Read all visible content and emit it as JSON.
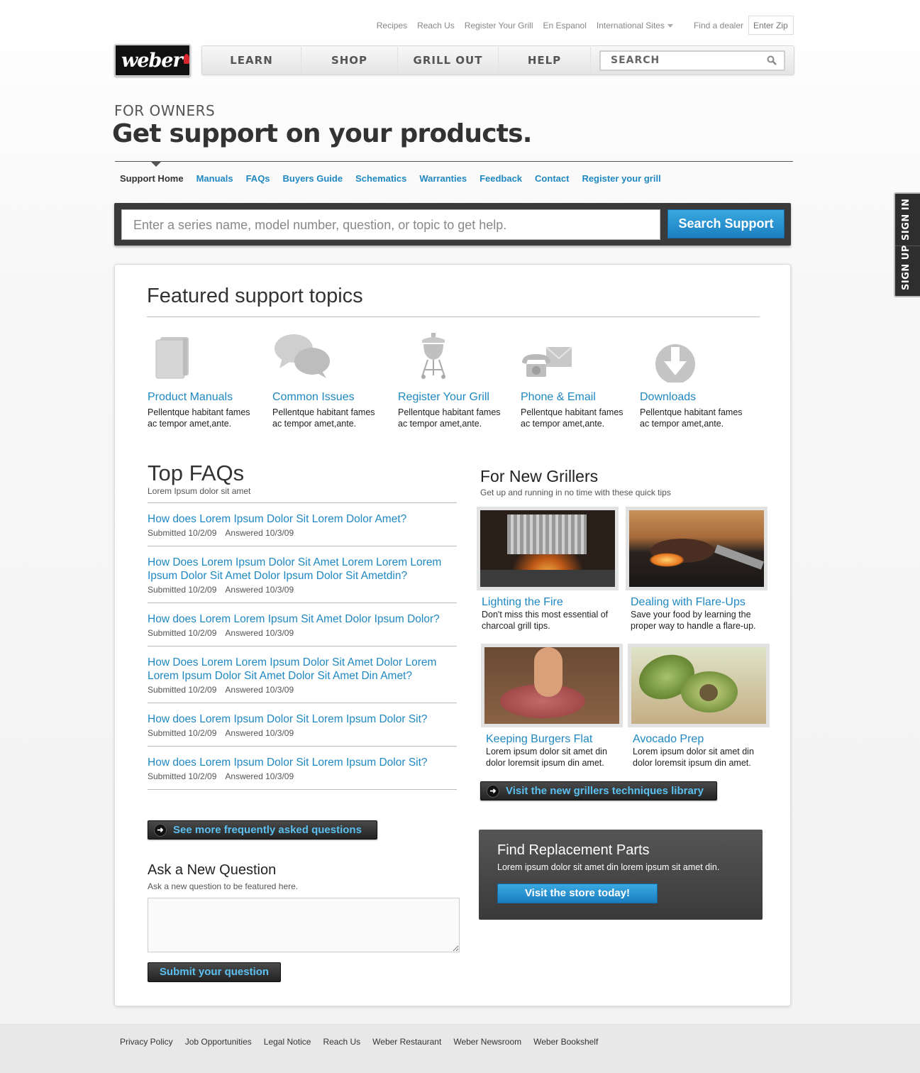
{
  "utility": {
    "links": [
      "Recipes",
      "Reach Us",
      "Register Your Grill",
      "En Espanol",
      "International Sites"
    ],
    "dealer_label": "Find a dealer",
    "zip_placeholder": "Enter Zip"
  },
  "logo": {
    "text": "weber"
  },
  "nav": {
    "items": [
      "LEARN",
      "SHOP",
      "GRILL OUT",
      "HELP"
    ],
    "search_placeholder": "SEARCH"
  },
  "page": {
    "eyebrow": "FOR OWNERS",
    "title": "Get support on your products."
  },
  "subnav": {
    "items": [
      "Support Home",
      "Manuals",
      "FAQs",
      "Buyers Guide",
      "Schematics",
      "Warranties",
      "Feedback",
      "Contact",
      "Register your grill"
    ]
  },
  "support_search": {
    "placeholder": "Enter a series name, model number, question, or topic to get help.",
    "button": "Search Support"
  },
  "sidetab": {
    "sign_in": "SIGN IN",
    "sign_up": "SIGN UP"
  },
  "featured": {
    "heading": "Featured support topics",
    "topics": [
      {
        "title": "Product Manuals",
        "desc": "Pellentque habitant fames ac tempor amet,ante.",
        "icon": "manual-icon"
      },
      {
        "title": "Common Issues",
        "desc": "Pellentque habitant fames ac tempor amet,ante.",
        "icon": "speech-bubbles-icon"
      },
      {
        "title": "Register Your Grill",
        "desc": "Pellentque habitant fames ac tempor amet,ante.",
        "icon": "grill-icon"
      },
      {
        "title": "Phone & Email",
        "desc": "Pellentque habitant fames ac tempor amet,ante.",
        "icon": "phone-email-icon"
      },
      {
        "title": "Downloads",
        "desc": "Pellentque habitant fames ac tempor amet,ante.",
        "icon": "download-icon"
      }
    ]
  },
  "faqs": {
    "heading": "Top FAQs",
    "sub": "Lorem Ipsum dolor sit amet",
    "items": [
      {
        "q": "How does Lorem Ipsum Dolor Sit Lorem Dolor Amet?",
        "submitted": "Submitted 10/2/09",
        "answered": "Answered 10/3/09"
      },
      {
        "q": "How Does Lorem Ipsum Dolor Sit Amet Lorem Lorem Lorem Ipsum Dolor Sit Amet Dolor Ipsum Dolor Sit Ametdin?",
        "submitted": "Submitted 10/2/09",
        "answered": "Answered 10/3/09"
      },
      {
        "q": "How does Lorem Lorem Ipsum Sit Amet Dolor Ipsum Dolor?",
        "submitted": "Submitted 10/2/09",
        "answered": "Answered 10/3/09"
      },
      {
        "q": "How Does Lorem Lorem Ipsum Dolor Sit Amet Dolor Lorem Lorem Ipsum Dolor Sit Amet Dolor Sit Amet Din Amet?",
        "submitted": "Submitted 10/2/09",
        "answered": "Answered 10/3/09"
      },
      {
        "q": "How does Lorem Ipsum Dolor Sit Lorem Ipsum Dolor Sit?",
        "submitted": "Submitted 10/2/09",
        "answered": "Answered 10/3/09"
      },
      {
        "q": "How does Lorem Ipsum Dolor Sit Lorem Ipsum Dolor Sit?",
        "submitted": "Submitted 10/2/09",
        "answered": "Answered 10/3/09"
      }
    ],
    "more_button": "See more frequently asked questions"
  },
  "ask": {
    "heading": "Ask a New Question",
    "sub": "Ask a new question to be featured here.",
    "submit": "Submit your question"
  },
  "grillers": {
    "heading": "For New Grillers",
    "sub": "Get up and running in no time with these quick tips",
    "tiles": [
      {
        "title": "Lighting the Fire",
        "desc": "Don't miss this most essential of charcoal grill tips."
      },
      {
        "title": "Dealing with Flare-Ups",
        "desc": "Save your food by learning the proper way to handle a flare-up."
      },
      {
        "title": "Keeping Burgers Flat",
        "desc": "Lorem ipsum dolor sit amet din dolor loremsit ipsum din amet."
      },
      {
        "title": "Avocado Prep",
        "desc": "Lorem ipsum dolor sit amet din dolor loremsit ipsum din amet."
      }
    ],
    "library_button": "Visit the new grillers techniques library"
  },
  "parts": {
    "title": "Find Replacement Parts",
    "desc": "Lorem ipsum dolor sit amet din lorem ipsum sit amet din.",
    "button": "Visit the store today!"
  },
  "footer": {
    "links": [
      "Privacy Policy",
      "Job Opportunities",
      "Legal Notice",
      "Reach Us",
      "Weber Restaurant",
      "Weber Newsroom",
      "Weber Bookshelf"
    ]
  },
  "colors": {
    "link": "#1f88c2",
    "button_blue": "#2390cf",
    "brand_red": "#d8262f"
  }
}
